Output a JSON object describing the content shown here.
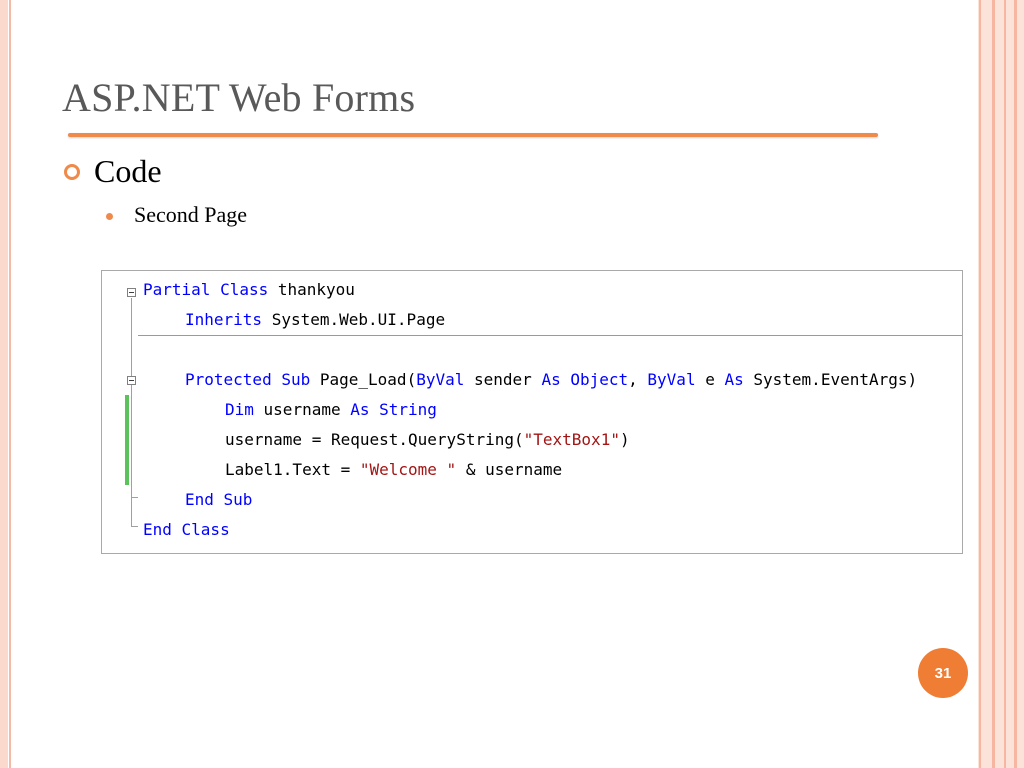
{
  "slide": {
    "title": "ASP.NET Web Forms",
    "bullet_level1": "Code",
    "bullet_level2": "Second Page",
    "page_number": "31",
    "accent_color": "#ef8a4a"
  },
  "code": {
    "lines": [
      [
        {
          "t": "Partial Class",
          "c": "kw"
        },
        {
          "t": " thankyou"
        }
      ],
      [
        {
          "t": "Inherits",
          "c": "kw"
        },
        {
          "t": " System.Web.UI.Page"
        }
      ],
      [],
      [
        {
          "t": "Protected Sub",
          "c": "kw"
        },
        {
          "t": " Page_Load("
        },
        {
          "t": "ByVal",
          "c": "kw"
        },
        {
          "t": " sender "
        },
        {
          "t": "As Object",
          "c": "kw"
        },
        {
          "t": ", "
        },
        {
          "t": "ByVal",
          "c": "kw"
        },
        {
          "t": " e "
        },
        {
          "t": "As",
          "c": "kw"
        },
        {
          "t": " System.EventArgs)"
        }
      ],
      [
        {
          "t": "Dim",
          "c": "kw"
        },
        {
          "t": " username "
        },
        {
          "t": "As String",
          "c": "kw"
        }
      ],
      [
        {
          "t": "username = Request.QueryString("
        },
        {
          "t": "\"TextBox1\"",
          "c": "str"
        },
        {
          "t": ")"
        }
      ],
      [
        {
          "t": "Label1.Text = "
        },
        {
          "t": "\"Welcome \"",
          "c": "str"
        },
        {
          "t": " & username"
        }
      ],
      [
        {
          "t": "End Sub",
          "c": "kw"
        }
      ],
      [
        {
          "t": "End Class",
          "c": "kw"
        }
      ]
    ]
  }
}
